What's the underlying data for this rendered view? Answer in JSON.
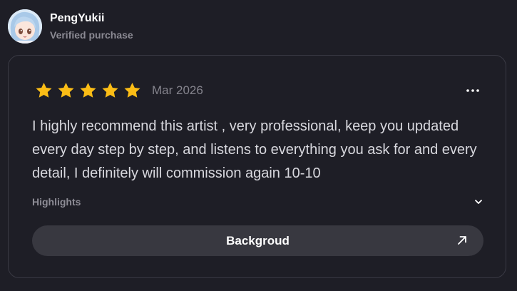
{
  "reviewer": {
    "name": "PengYukii",
    "status": "Verified purchase",
    "avatar_icon": "anime-girl-avatar"
  },
  "review": {
    "rating": 5,
    "rating_max": 5,
    "date": "Mar 2026",
    "text": "I highly recommend this artist , very professional, keep you updated every day step by step, and listens to everything you ask for and every detail, I definitely will commission again 10-10",
    "more_icon": "more-horizontal-icon"
  },
  "highlights": {
    "label": "Highlights",
    "toggle_icon": "chevron-down-icon",
    "items": [
      {
        "label": "Backgroud",
        "icon": "arrow-up-right-icon"
      }
    ]
  },
  "colors": {
    "background": "#1e1e26",
    "star": "#fbbd16",
    "chip": "#383840",
    "border": "#3a3a44"
  }
}
